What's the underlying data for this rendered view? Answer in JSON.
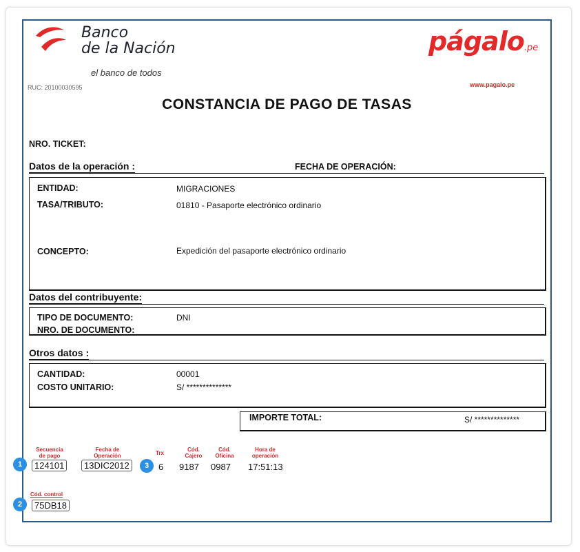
{
  "header": {
    "bank_name_line1": "Banco",
    "bank_name_line2": "de la Nación",
    "bank_tagline": "el banco de todos",
    "ruc": "RUC: 20100030595",
    "pagalo_logo": "págalo",
    "pagalo_suffix": ".pe",
    "pagalo_url": "www.pagalo.pe",
    "title": "CONSTANCIA DE PAGO DE TASAS"
  },
  "ticket": {
    "label": "NRO. TICKET:"
  },
  "operacion": {
    "section_title": "Datos de la operación :",
    "fecha_label": "FECHA DE OPERACIÓN:",
    "entidad_label": "ENTIDAD:",
    "entidad_value": "MIGRACIONES",
    "tasa_label": "TASA/TRIBUTO:",
    "tasa_value": "01810 - Pasaporte electrónico ordinario",
    "concepto_label": "CONCEPTO:",
    "concepto_value": "Expedición del pasaporte electrónico ordinario"
  },
  "contribuyente": {
    "section_title": "Datos del contribuyente:",
    "tipo_doc_label": "TIPO DE DOCUMENTO:",
    "tipo_doc_value": "DNI",
    "nro_doc_label": "NRO. DE DOCUMENTO:"
  },
  "otros": {
    "section_title": "Otros datos :",
    "cantidad_label": "CANTIDAD:",
    "cantidad_value": "00001",
    "costo_label": "COSTO UNITARIO:",
    "costo_value": "S/  **************"
  },
  "total": {
    "label": "IMPORTE TOTAL:",
    "value": "S/  **************"
  },
  "footer": {
    "secuencia_label": "Secuencia de pago",
    "secuencia_value": "124101",
    "fecha_label": "Fecha de Operación",
    "fecha_value": "13DIC2012",
    "trx_label": "Trx",
    "trx_value": "6",
    "cajero_label": "Cód. Cajero",
    "cajero_value": "9187",
    "oficina_label": "Cód. Oficina",
    "oficina_value": "0987",
    "hora_label": "Hora de operación",
    "hora_value": "17:51:13",
    "control_label": "Cód. control",
    "control_value": "75DB18"
  },
  "markers": [
    "1",
    "2",
    "3"
  ],
  "colors": {
    "border": "#2c5a86",
    "brand_red": "#e32a2a",
    "marker_blue": "#2b8fe3"
  }
}
